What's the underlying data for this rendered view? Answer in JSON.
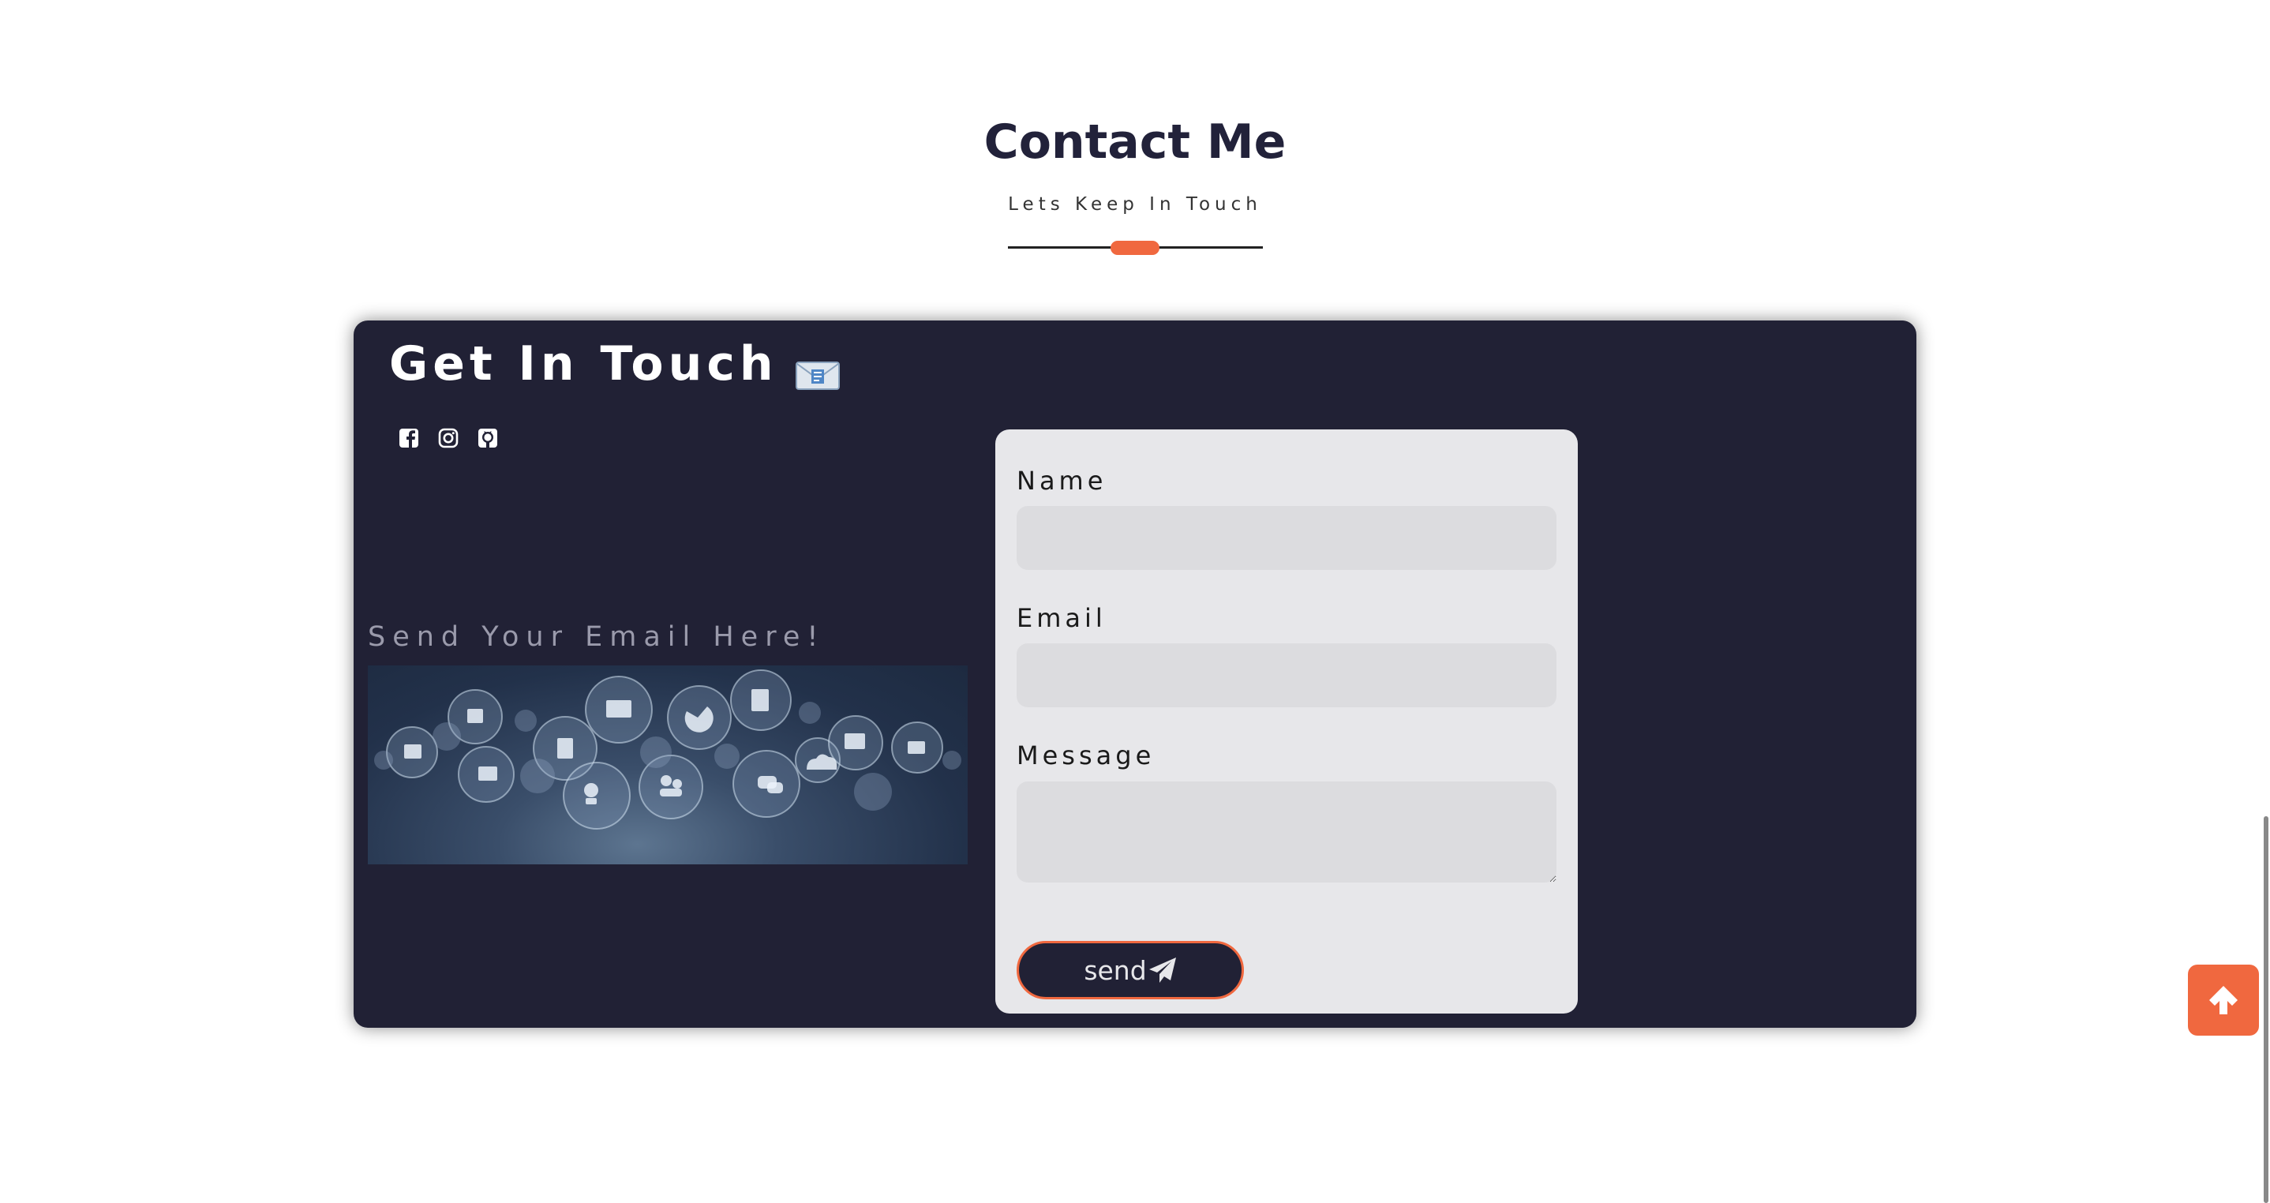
{
  "section": {
    "title": "Contact Me",
    "subtitle": "Lets Keep In Touch"
  },
  "card": {
    "title": "Get In Touch",
    "title_icon": "envelope-icon",
    "socials": [
      {
        "name": "facebook-icon"
      },
      {
        "name": "instagram-icon"
      },
      {
        "name": "github-icon"
      }
    ],
    "promo_text": "Send Your Email Here!"
  },
  "form": {
    "name_label": "Name",
    "name_value": "",
    "email_label": "Email",
    "email_value": "",
    "message_label": "Message",
    "message_value": "",
    "send_label": "send",
    "send_icon": "paper-plane-icon"
  },
  "scroll_top_icon": "arrow-up-icon",
  "colors": {
    "accent": "#f0683f",
    "card_bg": "#212135",
    "form_bg": "#e7e7ea",
    "title": "#22223a"
  }
}
